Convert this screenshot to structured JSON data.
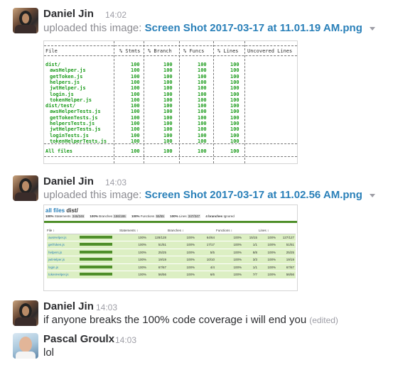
{
  "messages": [
    {
      "author": "Daniel Jin",
      "time": "14:02",
      "prefix": "uploaded this image:",
      "file": "Screen Shot 2017-03-17 at 11.01.19 AM.png"
    },
    {
      "author": "Daniel Jin",
      "time": "14:03",
      "prefix": "uploaded this image:",
      "file": "Screen Shot 2017-03-17 at 11.02.56 AM.png"
    },
    {
      "author": "Daniel Jin",
      "time": "14:03",
      "text": "if anyone breaks the 100% code coverage i will end you",
      "edited": "(edited)"
    },
    {
      "author": "Pascal Groulx",
      "time": "14:03",
      "text": "lol"
    }
  ],
  "terminal": {
    "headers": [
      "File",
      "% Stmts",
      "% Branch",
      "% Funcs",
      "% Lines",
      "Uncovered Lines"
    ],
    "rows": [
      {
        "file": "dist/",
        "vals": [
          "100",
          "100",
          "100",
          "100"
        ]
      },
      {
        "file": " awsHelper.js",
        "vals": [
          "100",
          "100",
          "100",
          "100"
        ]
      },
      {
        "file": " getToken.js",
        "vals": [
          "100",
          "100",
          "100",
          "100"
        ]
      },
      {
        "file": " helpers.js",
        "vals": [
          "100",
          "100",
          "100",
          "100"
        ]
      },
      {
        "file": " jwtHelper.js",
        "vals": [
          "100",
          "100",
          "100",
          "100"
        ]
      },
      {
        "file": " login.js",
        "vals": [
          "100",
          "100",
          "100",
          "100"
        ]
      },
      {
        "file": " tokenHelper.js",
        "vals": [
          "100",
          "100",
          "100",
          "100"
        ]
      },
      {
        "file": "dist/test/",
        "vals": [
          "100",
          "100",
          "100",
          "100"
        ]
      },
      {
        "file": " awsHelperTests.js",
        "vals": [
          "100",
          "100",
          "100",
          "100"
        ]
      },
      {
        "file": " getTokenTests.js",
        "vals": [
          "100",
          "100",
          "100",
          "100"
        ]
      },
      {
        "file": " helpersTests.js",
        "vals": [
          "100",
          "100",
          "100",
          "100"
        ]
      },
      {
        "file": " jwtHelperTests.js",
        "vals": [
          "100",
          "100",
          "100",
          "100"
        ]
      },
      {
        "file": " loginTests.js",
        "vals": [
          "100",
          "100",
          "100",
          "100"
        ]
      },
      {
        "file": " tokenHelperTests.js",
        "vals": [
          "100",
          "100",
          "100",
          "100"
        ]
      }
    ],
    "total": {
      "file": "All files",
      "vals": [
        "100",
        "100",
        "100",
        "100"
      ]
    }
  },
  "report": {
    "title_link": "all files",
    "title_rest": " dist/",
    "summary": [
      {
        "pct": "100%",
        "label": "Statements",
        "badge": "346/346"
      },
      {
        "pct": "100%",
        "label": "Branches",
        "badge": "186/186"
      },
      {
        "pct": "100%",
        "label": "Functions",
        "badge": "55/55"
      },
      {
        "pct": "100%",
        "label": "Lines",
        "badge": "347/347"
      }
    ],
    "ignored": "4 branches",
    "ignored_label": "Ignored",
    "headers": [
      "File ↕",
      "",
      "Statements ↕",
      "",
      "Branches ↕",
      "",
      "Functions ↕",
      "",
      "Lines ↕",
      ""
    ],
    "rows": [
      {
        "file": "awsHelper.js",
        "coverage": 1.0,
        "s": "100%",
        "sf": "128/128",
        "b": "100%",
        "bf": "64/64",
        "f": "100%",
        "ff": "15/15",
        "l": "100%",
        "lf": "127/127"
      },
      {
        "file": "getToken.js",
        "coverage": 1.0,
        "s": "100%",
        "sf": "51/51",
        "b": "100%",
        "bf": "17/17",
        "f": "100%",
        "ff": "1/1",
        "l": "100%",
        "lf": "51/51"
      },
      {
        "file": "helpers.js",
        "coverage": 1.0,
        "s": "100%",
        "sf": "25/25",
        "b": "100%",
        "bf": "5/5",
        "f": "100%",
        "ff": "8/8",
        "l": "100%",
        "lf": "25/25"
      },
      {
        "file": "jwtHelper.js",
        "coverage": 1.0,
        "s": "100%",
        "sf": "19/19",
        "b": "100%",
        "bf": "10/10",
        "f": "100%",
        "ff": "3/3",
        "l": "100%",
        "lf": "19/19"
      },
      {
        "file": "login.js",
        "coverage": 1.0,
        "s": "100%",
        "sf": "67/67",
        "b": "100%",
        "bf": "4/4",
        "f": "100%",
        "ff": "1/1",
        "l": "100%",
        "lf": "67/67"
      },
      {
        "file": "tokenHelper.js",
        "coverage": 1.0,
        "s": "100%",
        "sf": "56/56",
        "b": "100%",
        "bf": "6/6",
        "f": "100%",
        "ff": "7/7",
        "l": "100%",
        "lf": "56/56"
      }
    ]
  },
  "colors": {
    "link": "#2a80b9",
    "coverage_green": "#1b9b1b",
    "report_bar": "#4f8f2a",
    "row_bg": "#dcefc3"
  }
}
